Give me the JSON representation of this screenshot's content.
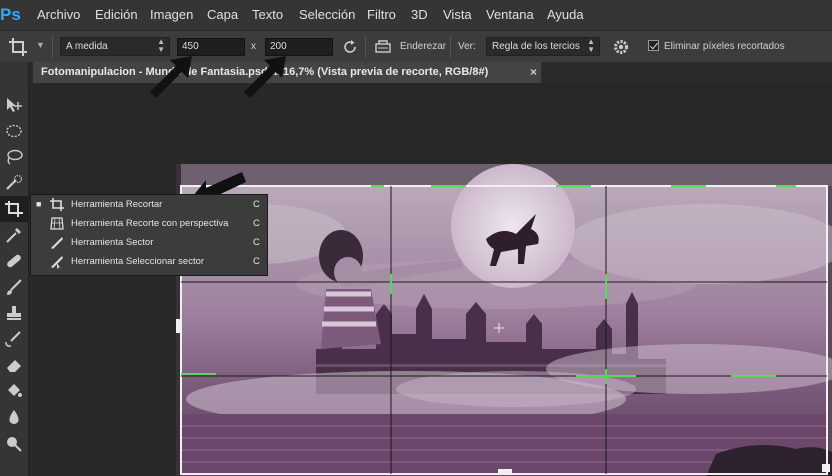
{
  "app": {
    "logo": "Ps"
  },
  "menu": [
    "Archivo",
    "Edición",
    "Imagen",
    "Capa",
    "Texto",
    "Selección",
    "Filtro",
    "3D",
    "Vista",
    "Ventana",
    "Ayuda"
  ],
  "options": {
    "ratio_preset": "A medida",
    "width_value": "450",
    "times_symbol": "x",
    "height_value": "200",
    "straighten_label": "Enderezar",
    "view_label": "Ver:",
    "overlay_value": "Regla de los tercios",
    "delete_cropped_checked": true,
    "delete_cropped_label": "Eliminar píxeles recortados"
  },
  "document": {
    "tab_title": "Fotomanipulacion - Mundo de Fantasia.psd al 16,7% (Vista previa de recorte, RGB/8#)",
    "close_symbol": "×"
  },
  "flyout": {
    "items": [
      {
        "label": "Herramienta Recortar",
        "shortcut": "C",
        "selected": true,
        "icon": "crop-icon",
        "bullet": "■"
      },
      {
        "label": "Herramienta Recorte con perspectiva",
        "shortcut": "C",
        "selected": false,
        "icon": "perspective-crop-icon",
        "bullet": ""
      },
      {
        "label": "Herramienta Sector",
        "shortcut": "C",
        "selected": false,
        "icon": "slice-icon",
        "bullet": ""
      },
      {
        "label": "Herramienta Seleccionar sector",
        "shortcut": "C",
        "selected": false,
        "icon": "slice-select-icon",
        "bullet": ""
      }
    ]
  },
  "tools": [
    "move-icon",
    "marquee-icon",
    "lasso-icon",
    "quick-select-icon",
    "crop-icon",
    "eyedropper-icon",
    "healing-icon",
    "brush-icon",
    "stamp-icon",
    "history-brush-icon",
    "eraser-icon",
    "paint-bucket-icon",
    "blur-icon",
    "dodge-icon"
  ],
  "colors": {
    "accent": "#31a8ff",
    "crop_handle": "#5cd65c",
    "image_tint": "#8a6a8a"
  }
}
